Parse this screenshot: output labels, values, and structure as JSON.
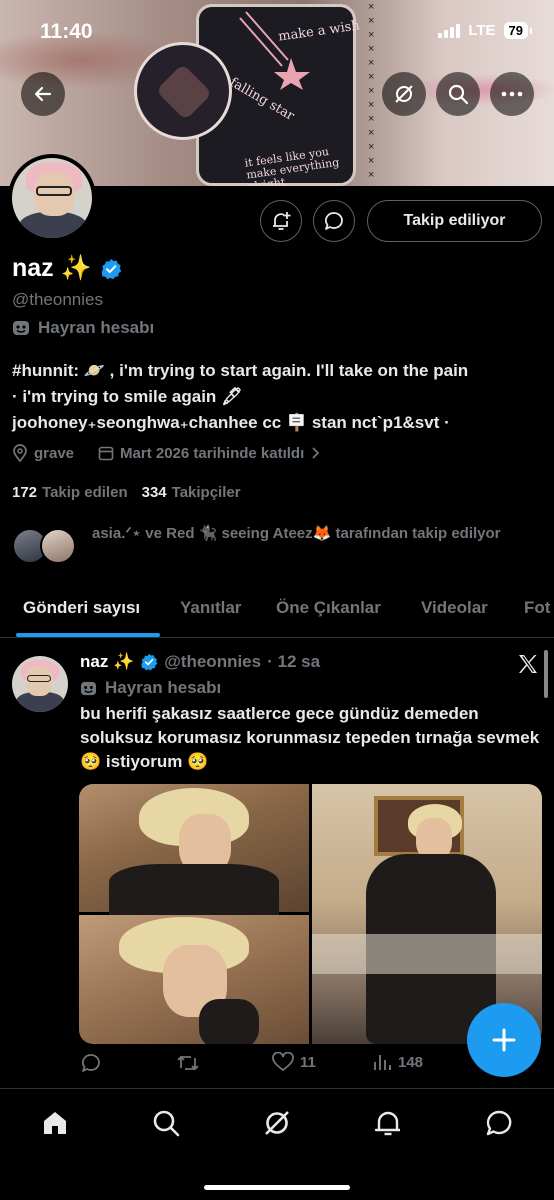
{
  "status_bar": {
    "time": "11:40",
    "network": "LTE",
    "battery": "79"
  },
  "profile": {
    "name": "naz ✨",
    "handle": "@theonnies",
    "label": "Hayran hesabı",
    "bio_lines": [
      "#hunnit: 🪐 , i'm trying to start again. I'll take on the pain",
      "· i'm trying to smile again 🖋",
      "joohoney₊seonghwa₊chanhee cc 🪧 stan nct`p1&svt ·"
    ],
    "location": "grave",
    "joined": "Mart 2026 tarihinde katıldı",
    "following_count": "172",
    "following_label": "Takip edilen",
    "followers_count": "334",
    "followers_label": "Takipçiler",
    "followed_by_text": "asia.ᐟ⋆ ve Red 🐈‍⬛ seeing Ateez🦊 tarafından takip edilyor",
    "follow_button": "Takip ediliyor"
  },
  "banner_text": {
    "note1": "make a wish",
    "note2": "falling star",
    "note3": "it feels like you make everything alright"
  },
  "tabs": [
    "Gönderi sayısı",
    "Yanıtlar",
    "Öne Çıkanlar",
    "Videolar",
    "Fot"
  ],
  "post": {
    "name": "naz ✨",
    "handle": "@theonnies",
    "time": "· 12 sa",
    "label": "Hayran hesabı",
    "text": "bu herifi şakasız saatlerce gece gündüz demeden soluksuz korumasız korunmasız tepeden tırnağa sevmek 🥺 istiyorum 🥺",
    "likes": "11",
    "views": "148"
  },
  "colors": {
    "accent": "#1d9bf0",
    "secondary_text": "#71767b",
    "border": "#2f3336"
  },
  "icons": [
    "back-arrow-icon",
    "grok-icon",
    "search-icon",
    "more-icon",
    "bell-plus-icon",
    "message-icon",
    "verified-icon",
    "mask-icon",
    "location-icon",
    "calendar-icon",
    "chevron-right-icon",
    "x-logo-icon",
    "reply-icon",
    "retweet-icon",
    "heart-icon",
    "views-icon",
    "plus-icon",
    "home-icon",
    "notifications-icon",
    "messages-icon"
  ]
}
